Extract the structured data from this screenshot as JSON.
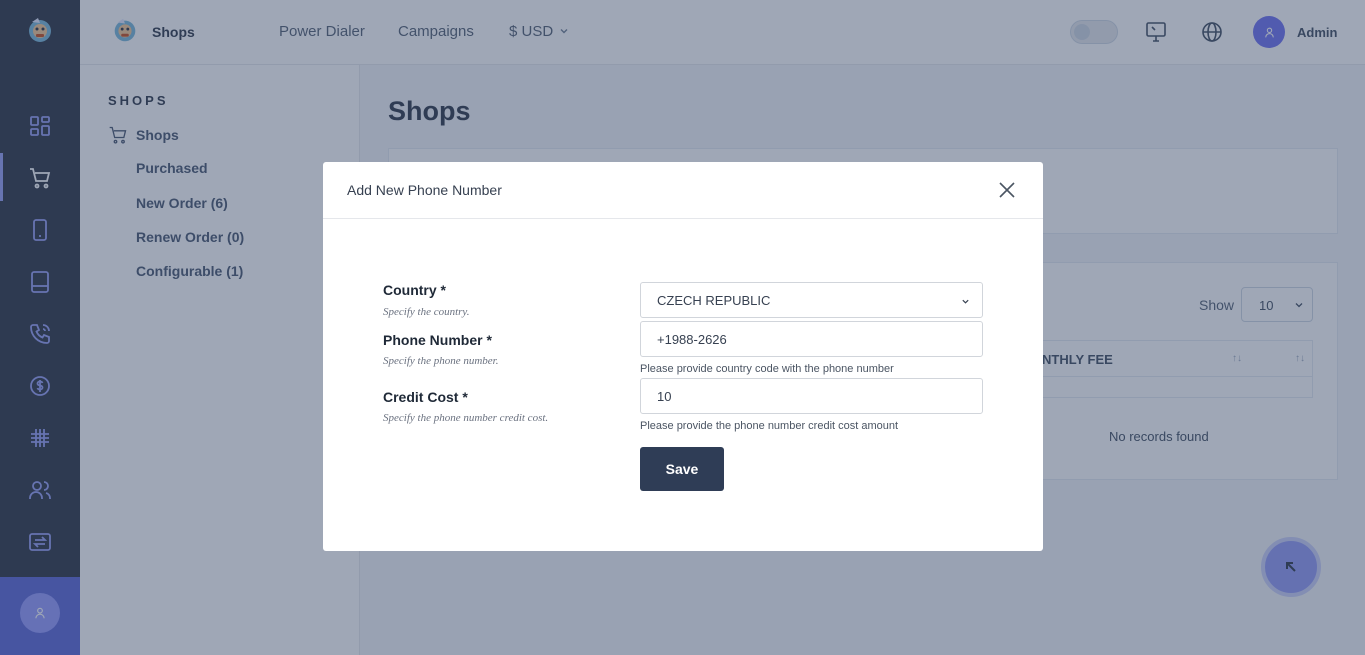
{
  "header": {
    "brand": "Shops",
    "nav": [
      "Power Dialer",
      "Campaigns",
      "$ USD"
    ],
    "user": "Admin"
  },
  "subnav": {
    "section": "SHOPS",
    "shops_label": "Shops",
    "items": [
      "Purchased",
      "New Order (6)",
      "Renew Order (0)",
      "Configurable (1)"
    ]
  },
  "main": {
    "title": "Shops",
    "show_label": "Show",
    "show_value": "10",
    "column_header": "NTHLY FEE",
    "empty_text": "No records found"
  },
  "modal": {
    "title": "Add New Phone Number",
    "fields": {
      "country": {
        "label": "Country *",
        "help": "Specify the country.",
        "value": "CZECH REPUBLIC"
      },
      "phone": {
        "label": "Phone Number *",
        "help": "Specify the phone number.",
        "value": "+1988-2626",
        "note": "Please provide country code with the phone number"
      },
      "credit": {
        "label": "Credit Cost *",
        "help": "Specify the phone number credit cost.",
        "value": "10",
        "note": "Please provide the phone number credit cost amount"
      }
    },
    "save_label": "Save"
  },
  "colors": {
    "rail_bg": "#1c2434",
    "accent": "#6366f1",
    "save_bg": "#2f3d56"
  }
}
